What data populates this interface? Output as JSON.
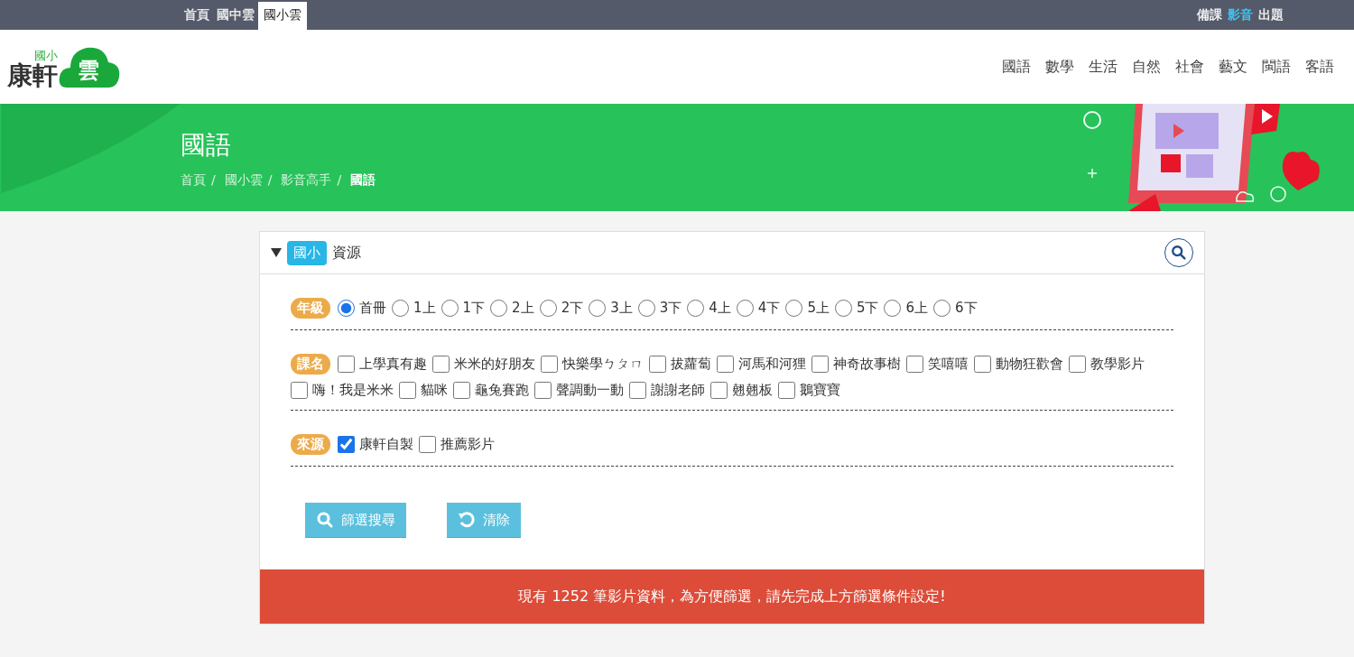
{
  "top_bar": {
    "site_tabs": [
      {
        "label": "首頁",
        "selected": false
      },
      {
        "label": "國中雲",
        "selected": false
      },
      {
        "label": "國小雲",
        "selected": true
      }
    ],
    "service_links": [
      {
        "label": "備課",
        "selected": false
      },
      {
        "label": "影音",
        "selected": true
      },
      {
        "label": "出題",
        "selected": false
      }
    ]
  },
  "header": {
    "logo": {
      "level": "國小",
      "brand": "康軒",
      "cloud": "雲"
    },
    "subjects": [
      "國語",
      "數學",
      "生活",
      "自然",
      "社會",
      "藝文",
      "閩語",
      "客語"
    ]
  },
  "banner": {
    "title": "國語",
    "separator": "/",
    "breadcrumb": [
      {
        "label": "首頁",
        "current": false
      },
      {
        "label": "國小雲",
        "current": false
      },
      {
        "label": "影音高手",
        "current": false
      },
      {
        "label": "國語",
        "current": true
      }
    ]
  },
  "panel": {
    "expanded": true,
    "badge": "國小",
    "title": "資源",
    "filters": [
      {
        "label": "年級",
        "kind": "radio",
        "options": [
          {
            "label": "首冊",
            "selected": true
          },
          {
            "label": "1上",
            "selected": false
          },
          {
            "label": "1下",
            "selected": false
          },
          {
            "label": "2上",
            "selected": false
          },
          {
            "label": "2下",
            "selected": false
          },
          {
            "label": "3上",
            "selected": false
          },
          {
            "label": "3下",
            "selected": false
          },
          {
            "label": "4上",
            "selected": false
          },
          {
            "label": "4下",
            "selected": false
          },
          {
            "label": "5上",
            "selected": false
          },
          {
            "label": "5下",
            "selected": false
          },
          {
            "label": "6上",
            "selected": false
          },
          {
            "label": "6下",
            "selected": false
          }
        ]
      },
      {
        "label": "課名",
        "kind": "checkbox",
        "options": [
          {
            "label": "上學真有趣",
            "checked": false
          },
          {
            "label": "米米的好朋友",
            "checked": false
          },
          {
            "label": "快樂學ㄅㄆㄇ",
            "checked": false
          },
          {
            "label": "拔蘿蔔",
            "checked": false
          },
          {
            "label": "河馬和河狸",
            "checked": false
          },
          {
            "label": "神奇故事樹",
            "checked": false
          },
          {
            "label": "笑嘻嘻",
            "checked": false
          },
          {
            "label": "動物狂歡會",
            "checked": false
          },
          {
            "label": "教學影片",
            "checked": false
          },
          {
            "label": "嗨！我是米米",
            "checked": false
          },
          {
            "label": "貓咪",
            "checked": false
          },
          {
            "label": "龜兔賽跑",
            "checked": false
          },
          {
            "label": "聲調動一動",
            "checked": false
          },
          {
            "label": "謝謝老師",
            "checked": false
          },
          {
            "label": "翹翹板",
            "checked": false
          },
          {
            "label": "鵝寶寶",
            "checked": false
          }
        ]
      },
      {
        "label": "來源",
        "kind": "checkbox",
        "options": [
          {
            "label": "康軒自製",
            "checked": true
          },
          {
            "label": "推薦影片",
            "checked": false
          }
        ]
      }
    ],
    "buttons": [
      {
        "label": "篩選搜尋",
        "kind": "search"
      },
      {
        "label": "清除",
        "kind": "reset"
      }
    ]
  },
  "notice": "現有 1252 筆影片資料，為方便篩選，請先完成上方篩選條件設定!"
}
